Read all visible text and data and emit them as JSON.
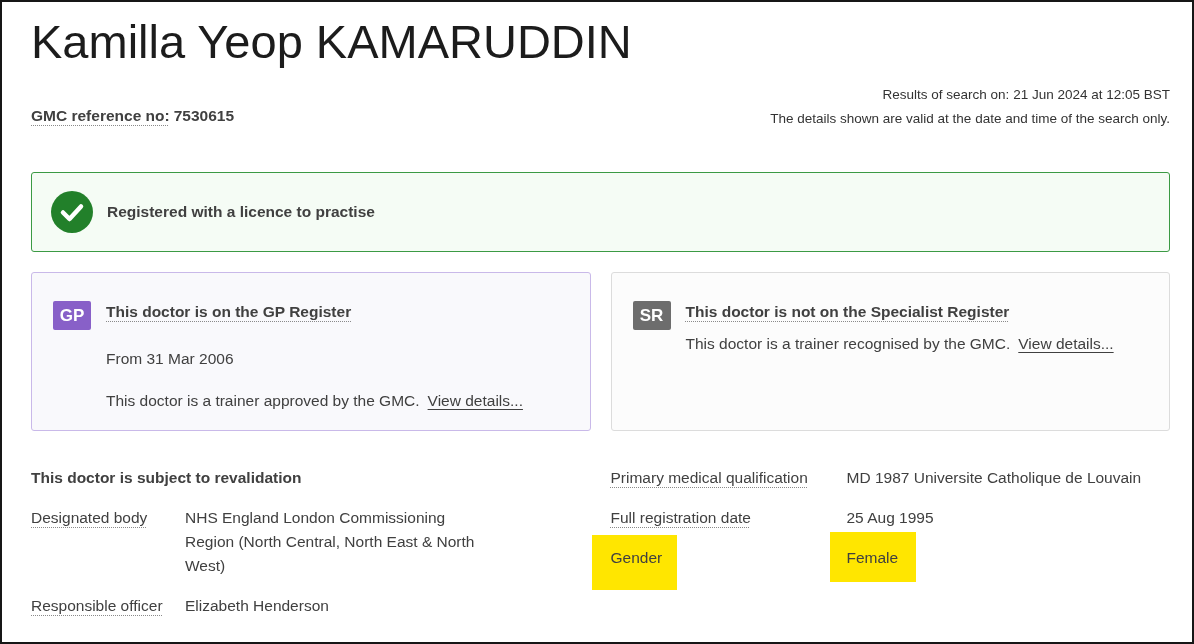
{
  "title": "Kamilla Yeop KAMARUDDIN",
  "reference": {
    "label": "GMC reference no:",
    "value": "7530615"
  },
  "search_info": [
    "Results of search on: 21 Jun 2024 at 12:05 BST",
    "The details shown are valid at the date and time of the search only."
  ],
  "status": {
    "kind": "success",
    "text": "Registered with a licence to practise"
  },
  "registers": [
    {
      "badge": "GP",
      "color": "#8860c8",
      "on_register": true,
      "heading": "This doctor is on the GP Register",
      "lines": [
        {
          "text": "From 31 Mar 2006"
        },
        {
          "text": "This doctor is a trainer approved by the GMC.",
          "link": "View details..."
        }
      ]
    },
    {
      "badge": "SR",
      "color": "#6d6d6d",
      "on_register": false,
      "heading": "This doctor is not on the Specialist Register",
      "lines": [
        {
          "text": "This doctor is a trainer recognised by the GMC.",
          "link": "View details..."
        }
      ]
    }
  ],
  "revalidation": {
    "heading": "This doctor is subject to revalidation",
    "rows": [
      {
        "label": "Designated body",
        "value": "NHS England London Commissioning Region (North Central, North East & North West)",
        "has_help": true,
        "highlighted": false
      },
      {
        "label": "Responsible officer",
        "value": "Elizabeth Henderson",
        "has_help": true,
        "highlighted": false
      }
    ]
  },
  "details": {
    "rows": [
      {
        "label": "Primary medical qualification",
        "value": "MD 1987 Universite Catholique de Louvain",
        "has_help": true,
        "highlighted": false
      },
      {
        "label": "Full registration date",
        "value": "25 Aug 1995",
        "has_help": true,
        "highlighted": false
      },
      {
        "label": "Gender",
        "value": "Female",
        "has_help": false,
        "highlighted": true
      }
    ]
  }
}
